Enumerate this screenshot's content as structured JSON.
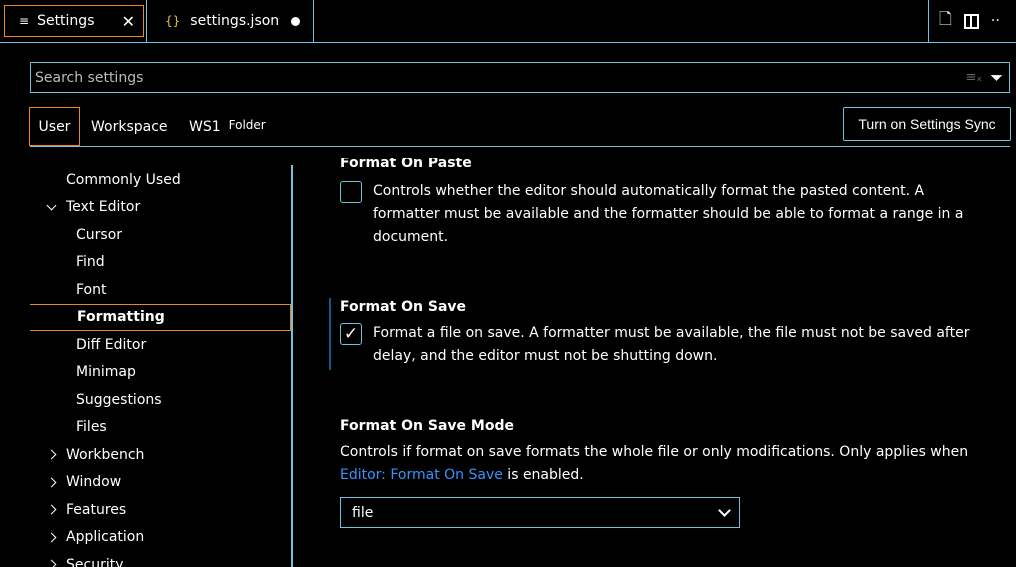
{
  "tabs": [
    {
      "label": "Settings",
      "icon": "settings-lines-icon"
    },
    {
      "label": "settings.json",
      "icon": "json-braces-icon",
      "dirty": true
    }
  ],
  "search": {
    "placeholder": "Search settings",
    "value": ""
  },
  "scopes": {
    "user": "User",
    "workspace": "Workspace",
    "folder": "WS1",
    "folder_badge": "Folder"
  },
  "sync_button": "Turn on Settings Sync",
  "tree": {
    "items": [
      "Commonly Used",
      "Text Editor",
      "Cursor",
      "Find",
      "Font",
      "Formatting",
      "Diff Editor",
      "Minimap",
      "Suggestions",
      "Files",
      "Workbench",
      "Window",
      "Features",
      "Application",
      "Security"
    ],
    "selected": "Formatting"
  },
  "settings": {
    "paste": {
      "title": "Format On Paste",
      "desc": "Controls whether the editor should automatically format the pasted content. A formatter must be available and the formatter should be able to format a range in a document.",
      "checked": false
    },
    "save": {
      "title": "Format On Save",
      "desc": "Format a file on save. A formatter must be available, the file must not be saved after delay, and the editor must not be shutting down.",
      "checked": true
    },
    "mode": {
      "title": "Format On Save Mode",
      "desc_pre": "Controls if format on save formats the whole file or only modifications. Only applies when",
      "link": "Editor: Format On Save",
      "desc_post": " is enabled.",
      "value": "file"
    }
  },
  "colors": {
    "border": "#6fc3df",
    "focus": "#f38518",
    "link": "#3794ff"
  }
}
